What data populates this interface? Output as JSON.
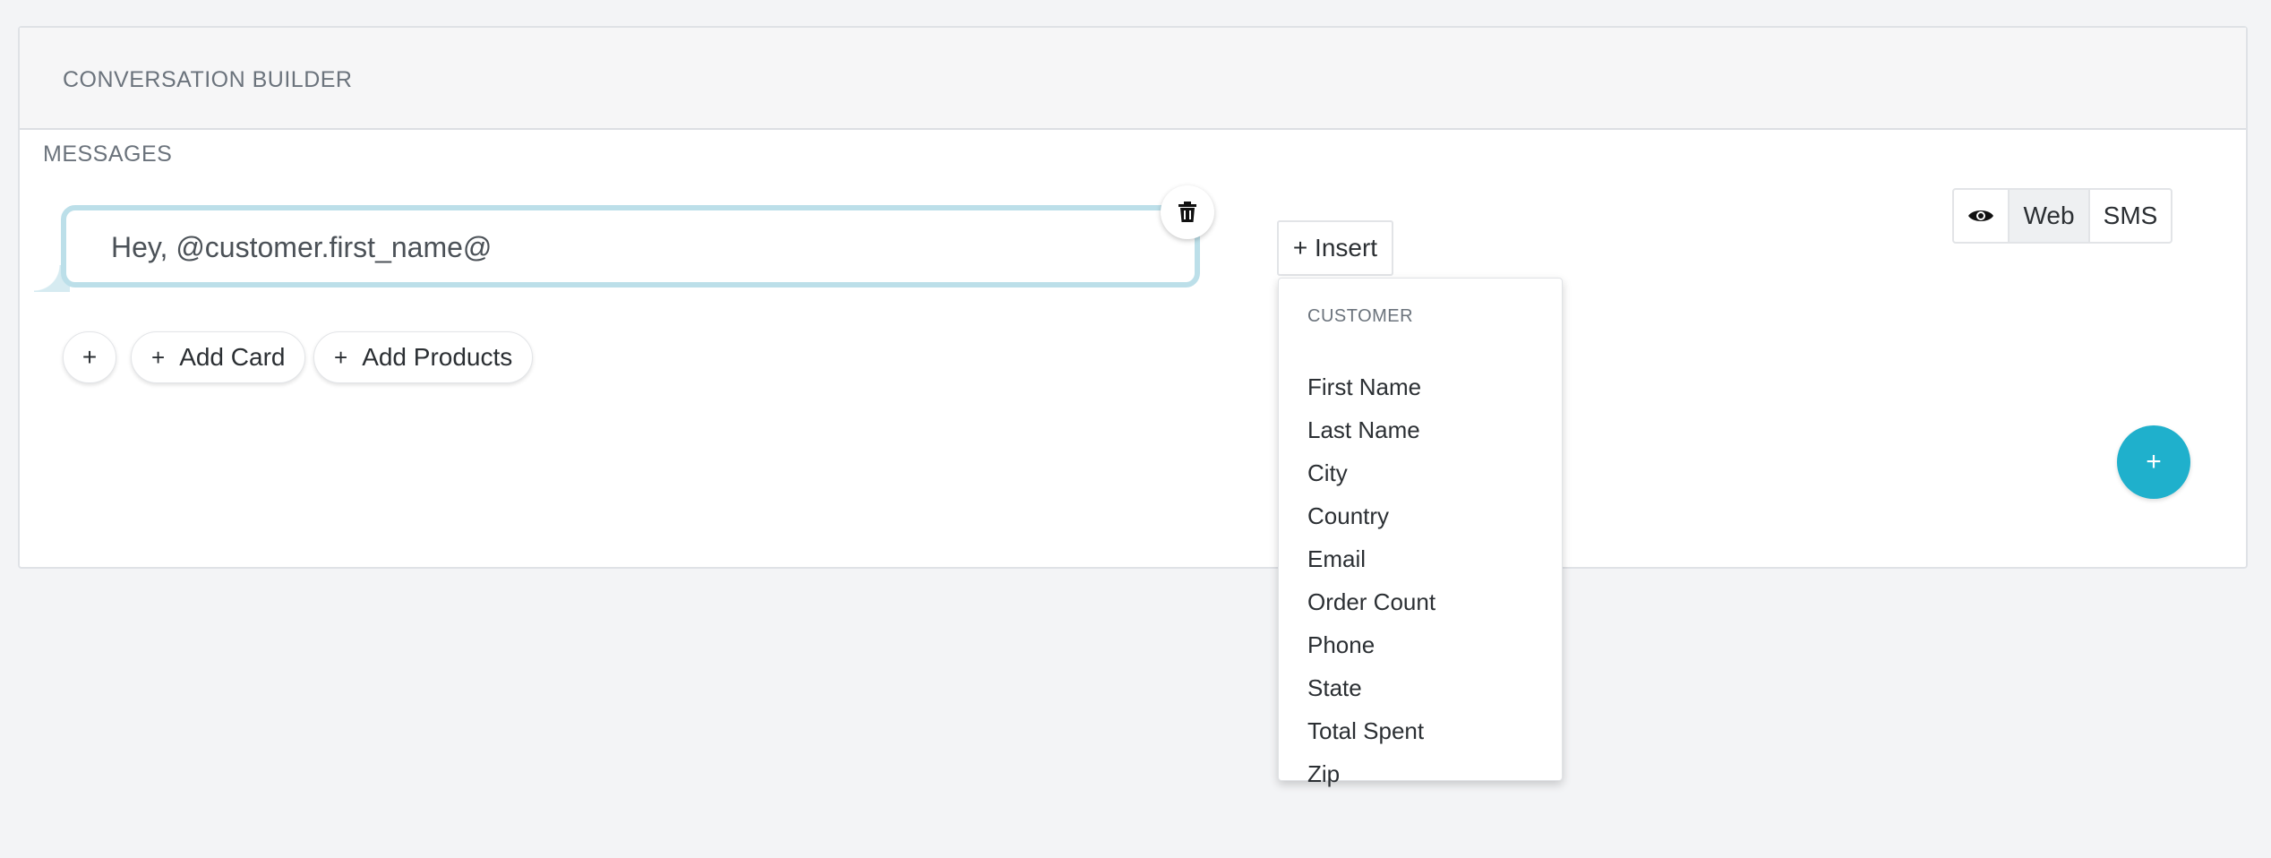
{
  "header": {
    "title": "CONVERSATION BUILDER"
  },
  "messages": {
    "section_label": "MESSAGES",
    "bubble_text": "Hey, @customer.first_name@"
  },
  "actions": {
    "add_symbol": "+",
    "add_card_label": "Add Card",
    "add_products_label": "Add Products"
  },
  "insert": {
    "button_label": "+ Insert",
    "dropdown": {
      "header": "CUSTOMER",
      "items": [
        "First Name",
        "Last Name",
        "City",
        "Country",
        "Email",
        "Order Count",
        "Phone",
        "State",
        "Total Spent",
        "Zip"
      ]
    }
  },
  "preview": {
    "icon": "eye-icon",
    "web_label": "Web",
    "sms_label": "SMS",
    "selected": "Web"
  },
  "fab": {
    "label": "+",
    "color": "#1fb0cc"
  }
}
